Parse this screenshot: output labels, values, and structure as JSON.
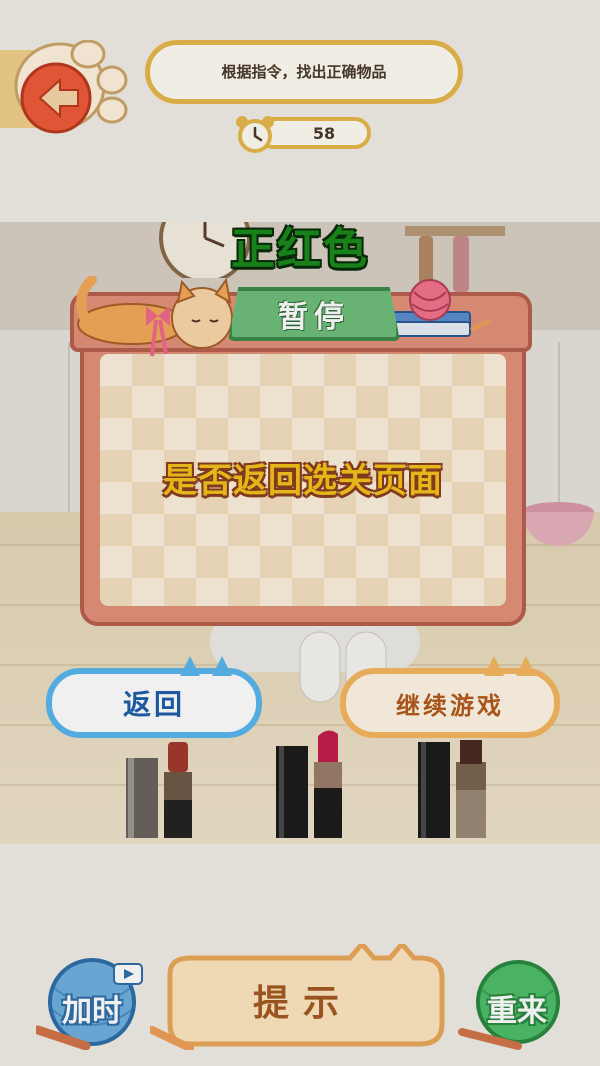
{
  "header": {
    "instruction": "根据指令，找出正确物品",
    "timer_value": "58",
    "back_icon": "back-arrow-icon",
    "timer_icon": "alarm-clock-icon"
  },
  "scene": {
    "target_word": "正红色",
    "items": [
      "lipstick-nude",
      "lipstick-red",
      "lipstick-brown"
    ]
  },
  "dialog": {
    "title": "暂停",
    "message": "是否返回选关页面",
    "return_label": "返回",
    "continue_label": "继续游戏"
  },
  "bottom_bar": {
    "add_time_label": "加时",
    "hint_label": "提示",
    "restart_label": "重来"
  },
  "colors": {
    "word": "#1b8a1b",
    "accent_gold": "#e6b84d",
    "dialog_frame": "#e3917a",
    "return_blue": "#5ab6ee",
    "continue_orange": "#f5b75f"
  }
}
